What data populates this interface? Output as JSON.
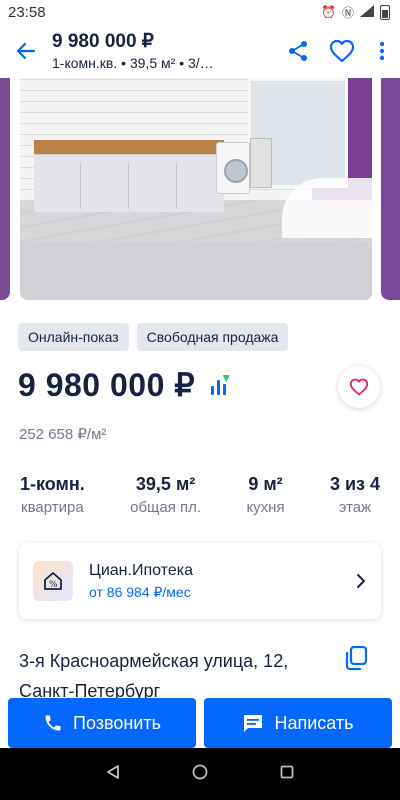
{
  "status_bar": {
    "time": "23:58"
  },
  "header": {
    "price": "9 980 000 ₽",
    "subtitle": "1-комн.кв.  •  39,5 м²  •  3/…"
  },
  "tags": [
    "Онлайн-показ",
    "Свободная продажа"
  ],
  "price": {
    "value": "9 980 000 ₽",
    "per_sqm": "252 658 ₽/м²"
  },
  "facts": [
    {
      "value": "1-комн.",
      "label": "квартира"
    },
    {
      "value": "39,5 м²",
      "label": "общая пл."
    },
    {
      "value": "9 м²",
      "label": "кухня"
    },
    {
      "value": "3 из 4",
      "label": "этаж"
    }
  ],
  "mortgage": {
    "title": "Циан.Ипотека",
    "subtitle": "от 86 984 ₽/мес"
  },
  "address": "3-я Красноармейская улица, 12, Санкт-Петербург",
  "actions": {
    "call_label": "Позвонить",
    "message_label": "Написать"
  },
  "colors": {
    "accent": "#0468ff",
    "text": "#152242",
    "muted": "#737a8e",
    "favorite": "#e0245e"
  }
}
